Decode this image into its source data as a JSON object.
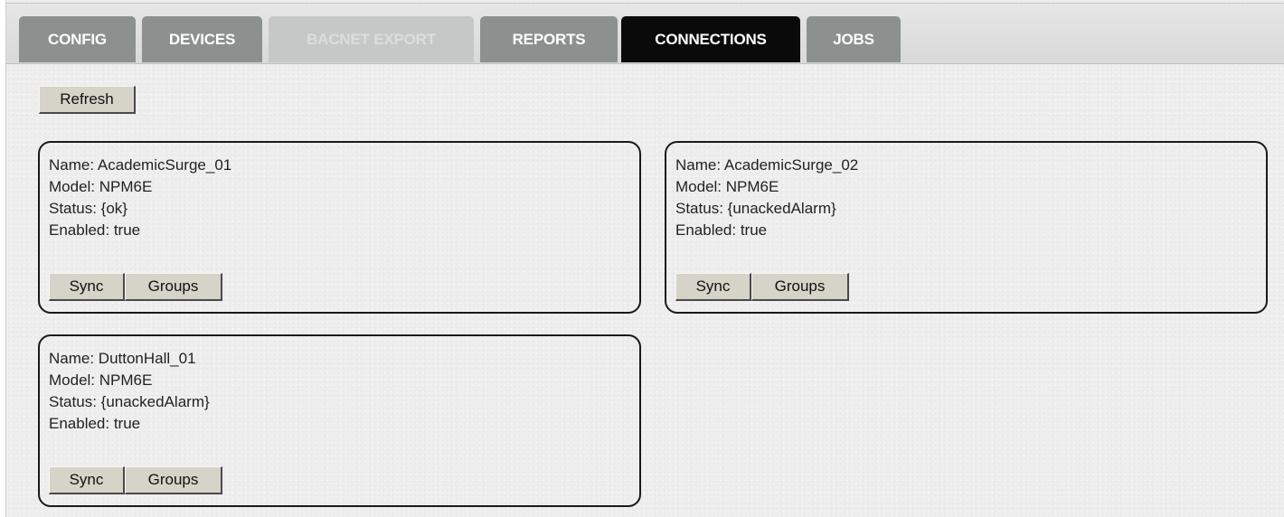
{
  "tabs": [
    {
      "label": "CONFIG",
      "state": "normal"
    },
    {
      "label": "DEVICES",
      "state": "normal"
    },
    {
      "label": "BACNET EXPORT",
      "state": "disabled"
    },
    {
      "label": "REPORTS",
      "state": "normal"
    },
    {
      "label": "CONNECTIONS",
      "state": "active"
    },
    {
      "label": "JOBS",
      "state": "normal"
    }
  ],
  "toolbar": {
    "refresh_label": "Refresh"
  },
  "connections": [
    {
      "name": "Name: AcademicSurge_01",
      "model": "Model: NPM6E",
      "status": "Status: {ok}",
      "enabled": "Enabled: true",
      "sync_label": "Sync",
      "groups_label": "Groups"
    },
    {
      "name": "Name: AcademicSurge_02",
      "model": "Model: NPM6E",
      "status": "Status: {unackedAlarm}",
      "enabled": "Enabled: true",
      "sync_label": "Sync",
      "groups_label": "Groups"
    },
    {
      "name": "Name: DuttonHall_01",
      "model": "Model: NPM6E",
      "status": "Status: {unackedAlarm}",
      "enabled": "Enabled: true",
      "sync_label": "Sync",
      "groups_label": "Groups"
    }
  ],
  "colors": {
    "tab_normal": "#8c918f",
    "tab_active": "#0a0a0a",
    "tab_disabled": "#c6c8c7",
    "button_face": "#d6d3c8",
    "background": "#eeeeee"
  }
}
